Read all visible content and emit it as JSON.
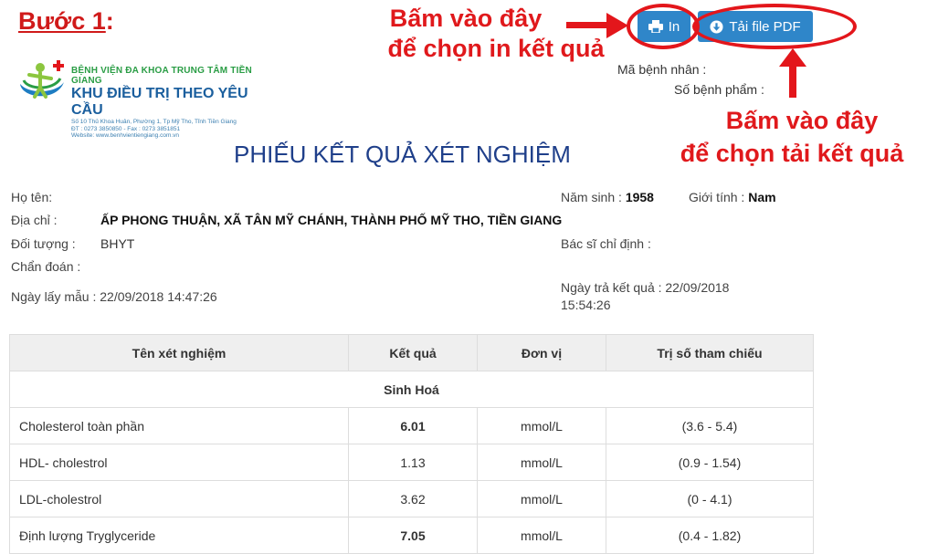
{
  "annotation": {
    "step_label": "Bước 1",
    "step_colon": ":",
    "print_note_line1": "Bấm vào đây",
    "print_note_line2": "để chọn in kết quả",
    "pdf_note_line1": "Bấm vào đây",
    "pdf_note_line2": "để chọn tải kết quả"
  },
  "toolbar": {
    "print_label": "In",
    "pdf_label": "Tải file PDF"
  },
  "logo": {
    "line1": "BỆNH VIỆN ĐA KHOA TRUNG TÂM TIỀN GIANG",
    "line2": "KHU ĐIỀU TRỊ THEO YÊU CẦU",
    "line3": "Số 10 Thủ Khoa Huân, Phường 1, Tp Mỹ Tho, Tỉnh Tiền Giang",
    "line4": "ĐT : 0273 3850850 - Fax : 0273 3851851",
    "line5": "Website: www.benhvientiengiang.com.vn"
  },
  "header_meta": {
    "patient_id_label": "Mã bệnh nhân :",
    "sample_no_label": "Số bệnh phẩm :"
  },
  "report": {
    "title": "PHIẾU KẾT QUẢ XÉT NGHIỆM",
    "name_label": "Họ tên:",
    "address_label": "Địa chỉ :",
    "address_value": "ẤP PHONG THUẬN, XÃ TÂN MỸ CHÁNH, THÀNH PHỐ MỸ THO, TIỀN GIANG",
    "subject_label": "Đối tượng :",
    "subject_value": "BHYT",
    "diagnosis_label": "Chẩn đoán :",
    "sample_date": "Ngày lấy mẫu : 22/09/2018 14:47:26",
    "birth_label": "Năm sinh :",
    "birth_value": "1958",
    "gender_label": "Giới tính :",
    "gender_value": "Nam",
    "doctor_label": "Bác sĩ chỉ định :",
    "result_date_line1": "Ngày trả kết quả : 22/09/2018",
    "result_date_line2": "15:54:26"
  },
  "table": {
    "headers": [
      "Tên xét nghiệm",
      "Kết quả",
      "Đơn vị",
      "Trị số tham chiếu"
    ],
    "group": "Sinh Hoá",
    "rows": [
      {
        "name": "Cholesterol toàn phần",
        "result": "6.01",
        "unit": "mmol/L",
        "ref": "(3.6 - 5.4)"
      },
      {
        "name": "HDL- cholestrol",
        "result": "1.13",
        "unit": "mmol/L",
        "ref": "(0.9 - 1.54)"
      },
      {
        "name": "LDL-cholestrol",
        "result": "3.62",
        "unit": "mmol/L",
        "ref": "(0 - 4.1)"
      },
      {
        "name": "Định lượng Tryglyceride",
        "result": "7.05",
        "unit": "mmol/L",
        "ref": "(0.4 - 1.82)"
      }
    ]
  },
  "colors": {
    "annotation_red": "#e3161b",
    "button_blue": "#2f86c9",
    "title_blue": "#1f3f8a"
  }
}
